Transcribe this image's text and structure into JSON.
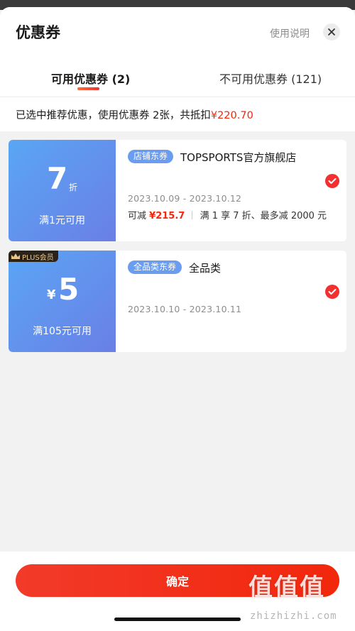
{
  "header": {
    "title": "优惠券",
    "help_label": "使用说明"
  },
  "tabs": [
    {
      "label": "可用优惠券 (2)",
      "active": true
    },
    {
      "label": "不可用优惠券 (121)",
      "active": false
    }
  ],
  "summary": {
    "text": "已选中推荐优惠，使用优惠券 2张，共抵扣",
    "amount": "¥220.70"
  },
  "coupons": [
    {
      "discount": "7",
      "discount_unit": "折",
      "condition": "满1元可用",
      "tag": "店铺东券",
      "shop": "TOPSPORTS官方旗舰店",
      "dates": "2023.10.09 - 2023.10.12",
      "save_prefix": "可减",
      "save_amount": "¥215.7",
      "rule": "满 1 享 7 折、最多减 2000 元",
      "selected": true
    },
    {
      "badge": "PLUS会员",
      "currency": "¥",
      "amount": "5",
      "condition": "满105元可用",
      "tag": "全品类东券",
      "shop": "全品类",
      "dates": "2023.10.10 - 2023.10.11",
      "selected": true
    }
  ],
  "footer": {
    "confirm_label": "确定"
  },
  "watermark": {
    "big": "值值值",
    "small": "zhizhizhi.com"
  },
  "colors": {
    "accent_red": "#f2270c",
    "coupon_blue": "#6a7fe6",
    "tag_blue": "#6a9cf0"
  }
}
